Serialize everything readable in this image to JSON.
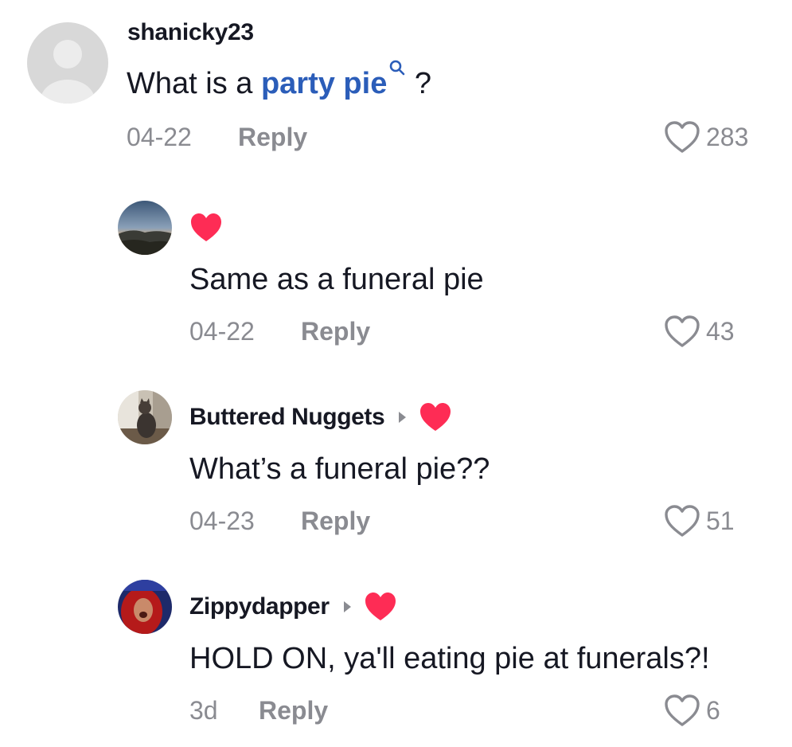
{
  "colors": {
    "text": "#161823",
    "muted": "#8a8b91",
    "link": "#2b5db9",
    "heart": "#fe2c55"
  },
  "comments": [
    {
      "username": "shanicky23",
      "text_before": "What is a ",
      "link_text": "party pie",
      "text_after": " ?",
      "date": "04-22",
      "reply": "Reply",
      "likes": "283",
      "avatar": "default-avatar-icon"
    },
    {
      "username": "",
      "text": "Same as a funeral pie",
      "date": "04-22",
      "reply": "Reply",
      "likes": "43",
      "avatar": "sunset-landscape-avatar",
      "badge": "red-heart-icon"
    },
    {
      "username": "Buttered Nuggets",
      "text": "What’s a funeral pie??",
      "date": "04-23",
      "reply": "Reply",
      "likes": "51",
      "avatar": "cat-at-window-avatar",
      "badge": "red-heart-icon"
    },
    {
      "username": "Zippydapper",
      "text": "HOLD ON, ya'll eating pie at funerals?!",
      "date": "3d",
      "reply": "Reply",
      "likes": "6",
      "avatar": "person-red-light-avatar",
      "badge": "red-heart-icon"
    }
  ]
}
